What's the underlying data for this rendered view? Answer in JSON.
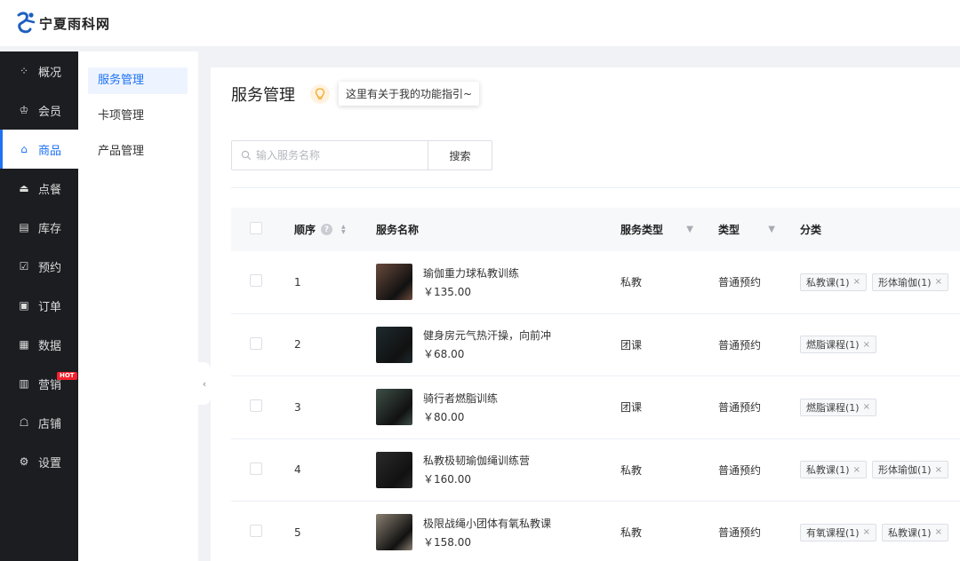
{
  "brand": {
    "name": "宁夏雨科网"
  },
  "sidebar": {
    "items": [
      {
        "label": "概况",
        "icon": "grid-icon",
        "glyph": "⁘",
        "active": false
      },
      {
        "label": "会员",
        "icon": "crown-icon",
        "glyph": "♔",
        "active": false
      },
      {
        "label": "商品",
        "icon": "store-icon",
        "glyph": "⌂",
        "active": true
      },
      {
        "label": "点餐",
        "icon": "food-cover-icon",
        "glyph": "⏏",
        "active": false
      },
      {
        "label": "库存",
        "icon": "warehouse-icon",
        "glyph": "▤",
        "active": false
      },
      {
        "label": "预约",
        "icon": "calendar-check-icon",
        "glyph": "☑",
        "active": false
      },
      {
        "label": "订单",
        "icon": "order-icon",
        "glyph": "▣",
        "active": false
      },
      {
        "label": "数据",
        "icon": "chart-icon",
        "glyph": "▦",
        "active": false
      },
      {
        "label": "营销",
        "icon": "marketing-icon",
        "glyph": "▥",
        "active": false,
        "badge": "HOT"
      },
      {
        "label": "店铺",
        "icon": "shop-icon",
        "glyph": "☖",
        "active": false
      },
      {
        "label": "设置",
        "icon": "settings-icon",
        "glyph": "⚙",
        "active": false
      }
    ]
  },
  "subnav": {
    "items": [
      {
        "label": "服务管理",
        "active": true
      },
      {
        "label": "卡项管理",
        "active": false
      },
      {
        "label": "产品管理",
        "active": false
      }
    ]
  },
  "page": {
    "title": "服务管理",
    "tip": "这里有关于我的功能指引~"
  },
  "search": {
    "placeholder": "输入服务名称",
    "button": "搜索"
  },
  "table": {
    "headers": {
      "order": "顺序",
      "name": "服务名称",
      "service_type": "服务类型",
      "type": "类型",
      "category": "分类"
    },
    "rows": [
      {
        "order": "1",
        "name": "瑜伽重力球私教训练",
        "price": "￥135.00",
        "service_type": "私教",
        "type": "普通预约",
        "tags": [
          "私教课(1)",
          "形体瑜伽(1)"
        ],
        "thumb_color": "#6a4a3c"
      },
      {
        "order": "2",
        "name": "健身房元气热汗操，向前冲",
        "price": "￥68.00",
        "service_type": "团课",
        "type": "普通预约",
        "tags": [
          "燃脂课程(1)"
        ],
        "thumb_color": "#1e2a2e"
      },
      {
        "order": "3",
        "name": "骑行者燃脂训练",
        "price": "￥80.00",
        "service_type": "团课",
        "type": "普通预约",
        "tags": [
          "燃脂课程(1)"
        ],
        "thumb_color": "#3e5048"
      },
      {
        "order": "4",
        "name": "私教极韧瑜伽绳训练营",
        "price": "￥160.00",
        "service_type": "私教",
        "type": "普通预约",
        "tags": [
          "私教课(1)",
          "形体瑜伽(1)"
        ],
        "thumb_color": "#2a2a2a"
      },
      {
        "order": "5",
        "name": "极限战绳小团体有氧私教课",
        "price": "￥158.00",
        "service_type": "私教",
        "type": "普通预约",
        "tags": [
          "有氧课程(1)",
          "私教课(1)"
        ],
        "thumb_color": "#8a7f70"
      }
    ]
  }
}
